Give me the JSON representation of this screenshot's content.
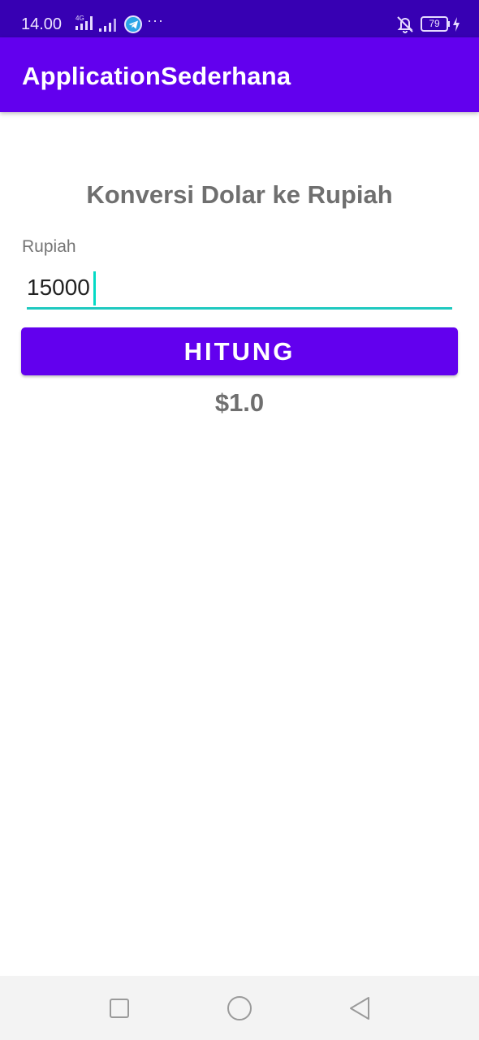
{
  "status_bar": {
    "time": "14.00",
    "network_type": "4G",
    "battery_level": "79",
    "icons": [
      "signal-4g-icon",
      "signal-icon",
      "telegram-icon",
      "more-notifications-icon",
      "mute-icon",
      "battery-icon",
      "charging-icon"
    ]
  },
  "app_bar": {
    "title": "ApplicationSederhana"
  },
  "main": {
    "heading": "Konversi Dolar ke Rupiah",
    "input_label": "Rupiah",
    "input_value": "15000",
    "button_label": "HITUNG",
    "result": "$1.0"
  },
  "nav_bar": {
    "icons": [
      "recent-apps-icon",
      "home-icon",
      "back-icon"
    ]
  },
  "colors": {
    "status_bar": "#3700b3",
    "primary": "#6200ee",
    "accent": "#03dac5",
    "text_gray": "#6f6f6f"
  }
}
